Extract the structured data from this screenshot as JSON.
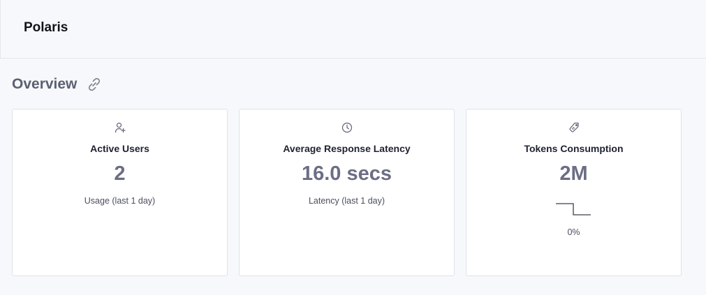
{
  "app": {
    "title": "Polaris"
  },
  "section": {
    "title": "Overview",
    "link_icon": "link-icon"
  },
  "cards": [
    {
      "icon": "user-plus-icon",
      "title": "Active Users",
      "value": "2",
      "subtitle": "Usage (last 1 day)"
    },
    {
      "icon": "clock-icon",
      "title": "Average Response Latency",
      "value": "16.0 secs",
      "subtitle": "Latency (last 1 day)"
    },
    {
      "icon": "tag-icon",
      "title": "Tokens Consumption",
      "value": "2M",
      "change": "0%",
      "sparkline": [
        1,
        1,
        0,
        0,
        0
      ]
    }
  ],
  "colors": {
    "background": "#f7f8fb",
    "card": "#ffffff",
    "value": "#6b6e84",
    "section_title": "#5b6171"
  }
}
